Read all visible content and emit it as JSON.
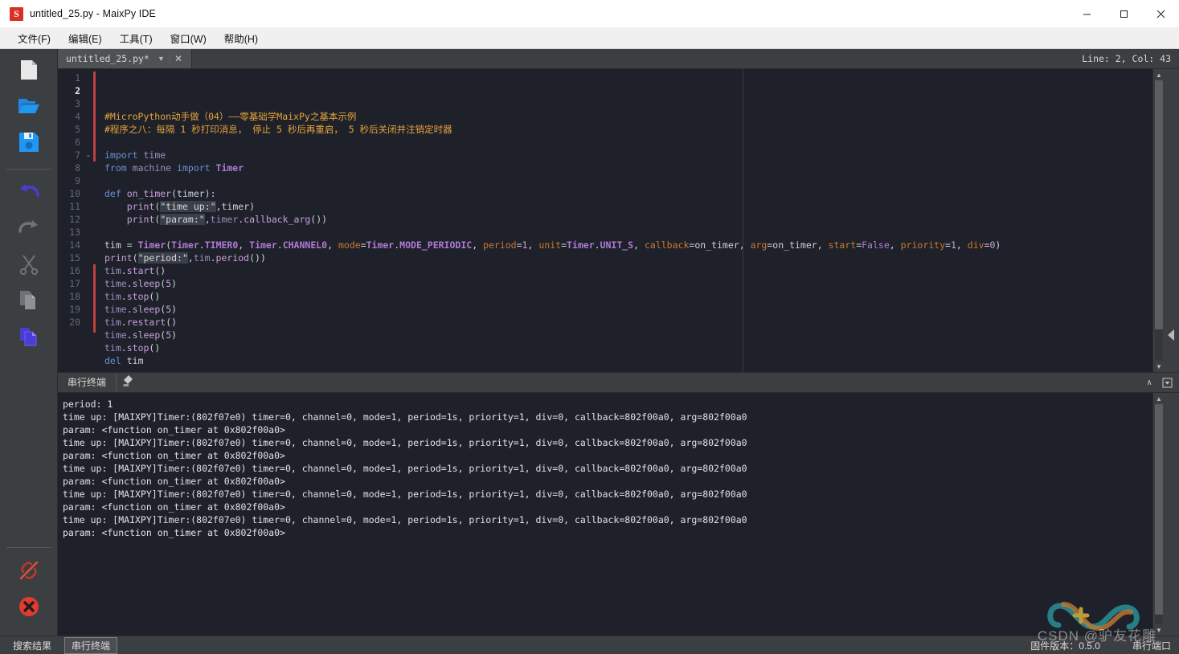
{
  "window": {
    "title": "untitled_25.py - MaixPy IDE",
    "app_icon": "S",
    "minimize": "−",
    "maximize": "□",
    "close": "✕"
  },
  "menubar": {
    "items": [
      {
        "label": "文件(F)",
        "name": "menu-file"
      },
      {
        "label": "编辑(E)",
        "name": "menu-edit"
      },
      {
        "label": "工具(T)",
        "name": "menu-tools"
      },
      {
        "label": "窗口(W)",
        "name": "menu-window"
      },
      {
        "label": "帮助(H)",
        "name": "menu-help"
      }
    ]
  },
  "toolbar": {
    "items": [
      {
        "name": "new-file-icon",
        "label": "新建文件",
        "enabled": true
      },
      {
        "name": "open-folder-icon",
        "label": "打开文件",
        "enabled": true
      },
      {
        "name": "save-file-icon",
        "label": "保存文件",
        "enabled": true
      },
      {
        "name": "undo-icon",
        "label": "撤销",
        "enabled": true
      },
      {
        "name": "redo-icon",
        "label": "重做",
        "enabled": false
      },
      {
        "name": "cut-icon",
        "label": "剪切",
        "enabled": false
      },
      {
        "name": "copy-icon",
        "label": "复制",
        "enabled": false
      },
      {
        "name": "paste-icon",
        "label": "粘贴",
        "enabled": true
      }
    ],
    "bottom": [
      {
        "name": "disconnect-icon",
        "label": "断开连接"
      },
      {
        "name": "stop-icon",
        "label": "停止"
      }
    ]
  },
  "editor": {
    "tab": {
      "name": "untitled_25.py*",
      "dropdown_caret": "▼",
      "close": "✕"
    },
    "line_info": "Line: 2, Col: 43",
    "first_line_number": 1,
    "line_count": 20,
    "current_line": 2,
    "lines": [
      "#MicroPython动手做（04）——零基础学MaixPy之基本示例",
      "#程序之八：每隔 1 秒打印消息， 停止 5 秒后再重启， 5 秒后关闭并注销定时器",
      "",
      "import time",
      "from machine import Timer",
      "",
      "def on_timer(timer):",
      "    print(\"time up:\",timer)",
      "    print(\"param:\",timer.callback_arg())",
      "",
      "tim = Timer(Timer.TIMER0, Timer.CHANNEL0, mode=Timer.MODE_PERIODIC, period=1, unit=Timer.UNIT_S, callback=on_timer, arg=on_timer, start=False, priority=1, div=0)",
      "print(\"period:\",tim.period())",
      "tim.start()",
      "time.sleep(5)",
      "tim.stop()",
      "time.sleep(5)",
      "tim.restart()",
      "time.sleep(5)",
      "tim.stop()",
      "del tim"
    ],
    "fold_markers": {
      "7": "⌄"
    }
  },
  "terminal": {
    "header_label": "串行终端",
    "clear_icon": "clear-terminal-icon",
    "collapse_icon": "∧",
    "maximize_icon": "▭",
    "lines": [
      "period: 1",
      "time up: [MAIXPY]Timer:(802f07e0) timer=0, channel=0, mode=1, period=1s, priority=1, div=0, callback=802f00a0, arg=802f00a0",
      "param: <function on_timer at 0x802f00a0>",
      "time up: [MAIXPY]Timer:(802f07e0) timer=0, channel=0, mode=1, period=1s, priority=1, div=0, callback=802f00a0, arg=802f00a0",
      "param: <function on_timer at 0x802f00a0>",
      "time up: [MAIXPY]Timer:(802f07e0) timer=0, channel=0, mode=1, period=1s, priority=1, div=0, callback=802f00a0, arg=802f00a0",
      "param: <function on_timer at 0x802f00a0>",
      "time up: [MAIXPY]Timer:(802f07e0) timer=0, channel=0, mode=1, period=1s, priority=1, div=0, callback=802f00a0, arg=802f00a0",
      "param: <function on_timer at 0x802f00a0>",
      "time up: [MAIXPY]Timer:(802f07e0) timer=0, channel=0, mode=1, period=1s, priority=1, div=0, callback=802f00a0, arg=802f00a0",
      "param: <function on_timer at 0x802f00a0>"
    ]
  },
  "statusbar": {
    "tabs": [
      {
        "label": "搜索结果",
        "active": false
      },
      {
        "label": "串行终端",
        "active": true
      }
    ],
    "firmware_label": "固件版本：0.5.0",
    "port_label": "串行端口"
  },
  "watermark": {
    "text": "CSDN @驴友花雕"
  },
  "colors": {
    "titlebar_bg": "#ffffff",
    "menubar_bg": "#f0f0f0",
    "chrome_bg": "#3c3f41",
    "editor_bg": "#1e2129",
    "accent_blue": "#2196f3",
    "accent_purple": "#4a3cd6",
    "stop_red": "#d93025",
    "comment": "#e8a33d",
    "keyword": "#6a8fd8",
    "kwarg": "#cc7832",
    "class": "#b07bd8",
    "function": "#c9a0dc"
  }
}
